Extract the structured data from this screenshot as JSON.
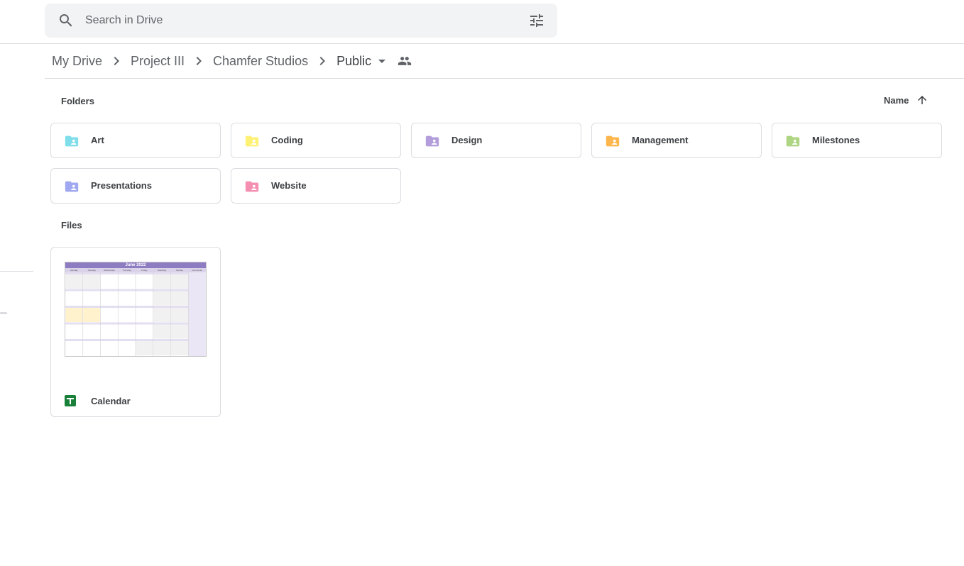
{
  "search": {
    "placeholder": "Search in Drive",
    "icon": "search-icon",
    "options_icon": "tune-icon"
  },
  "breadcrumb": {
    "items": [
      "My Drive",
      "Project III",
      "Chamfer Studios",
      "Public"
    ],
    "shared_icon": "people-icon"
  },
  "folders_section": {
    "label": "Folders",
    "sort_label": "Name",
    "sort_direction": "ascending",
    "items": [
      {
        "name": "Art",
        "color": "#80deea"
      },
      {
        "name": "Coding",
        "color": "#fff176"
      },
      {
        "name": "Design",
        "color": "#b39ddb"
      },
      {
        "name": "Management",
        "color": "#ffb74d"
      },
      {
        "name": "Milestones",
        "color": "#aed581"
      },
      {
        "name": "Presentations",
        "color": "#9fa8f0"
      },
      {
        "name": "Website",
        "color": "#f48fb1"
      }
    ]
  },
  "files_section": {
    "label": "Files",
    "items": [
      {
        "name": "Calendar",
        "type_icon": "google-sheets-icon",
        "thumbnail_title": "June 2022",
        "thumbnail_days": [
          "Monday",
          "Tuesday",
          "Wednesday",
          "Thursday",
          "Friday",
          "Saturday",
          "Sunday",
          "Comments"
        ]
      }
    ]
  },
  "colors": {
    "sheets_green": "#188038",
    "calendar_header": "#8e7cc3"
  }
}
